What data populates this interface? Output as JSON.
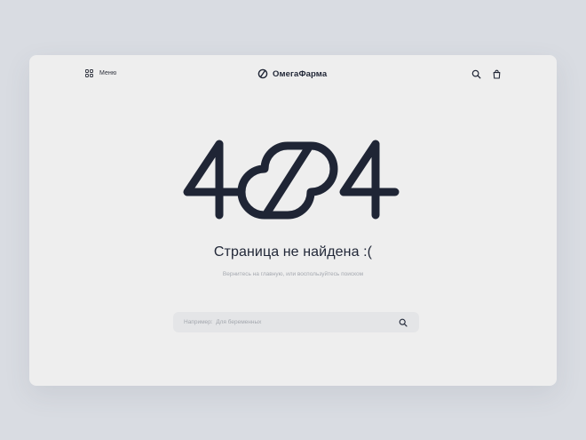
{
  "header": {
    "menu_label": "Меню",
    "menu_icon": "grid-icon",
    "logo_text": "ОмегаФарма",
    "logo_icon": "pill-logo-icon",
    "search_icon": "search-icon",
    "cart_icon": "shopping-bag-icon"
  },
  "error": {
    "code": "404",
    "title": "Страница не найдена :(",
    "subtitle": "Вернитесь на главную, или воспользуйтесь поиском"
  },
  "search": {
    "value": "",
    "placeholder": "Например:  Для беременных",
    "icon": "search-icon"
  },
  "colors": {
    "background": "#d9dce2",
    "card": "#eeeeee",
    "text_dark": "#1f2535",
    "text_muted": "#a5a9b0",
    "search_bg": "#e4e5e7"
  }
}
